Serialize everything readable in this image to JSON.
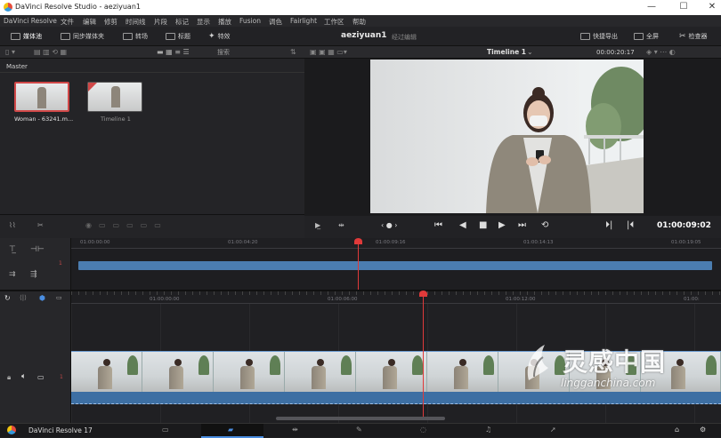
{
  "window": {
    "title": "DaVinci Resolve Studio - aeziyuan1",
    "min": "—",
    "max": "☐",
    "close": "✕"
  },
  "menu": [
    "DaVinci Resolve",
    "文件",
    "编辑",
    "修剪",
    "时间线",
    "片段",
    "标记",
    "显示",
    "播放",
    "Fusion",
    "调色",
    "Fairlight",
    "工作区",
    "帮助"
  ],
  "toolbar": {
    "media_pool": "媒体池",
    "sync_bin": "同步媒体夹",
    "transitions": "转场",
    "titles": "标题",
    "effects": "特效",
    "project_name": "aeziyuan1",
    "edited": "经过编辑",
    "quick_export": "快捷导出",
    "fullscreen": "全屏",
    "inspector": "检查器"
  },
  "media_pool": {
    "search_label": "搜索",
    "bin": "Master",
    "clips": [
      {
        "name": "Woman - 63241.m...",
        "selected": true
      },
      {
        "name": "Timeline 1",
        "selected": false
      }
    ]
  },
  "viewer": {
    "timeline_name": "Timeline 1",
    "timecode_top": "00:00:20:17",
    "timecode": "01:00:09:02"
  },
  "upper_ruler": [
    "01:00:00:00",
    "01:00:04:20",
    "01:00:09:16",
    "01:00:14:13",
    "01:00:19:05"
  ],
  "lower_ruler": [
    "01:00:00:00",
    "01:00:06:00",
    "01:00:12:00",
    "01:00:"
  ],
  "track_numbers": {
    "upper": "1",
    "lower": "1"
  },
  "bottom": {
    "app": "DaVinci Resolve 17"
  },
  "watermark": {
    "cn": "灵感中国",
    "url": "lingganchina.com"
  }
}
